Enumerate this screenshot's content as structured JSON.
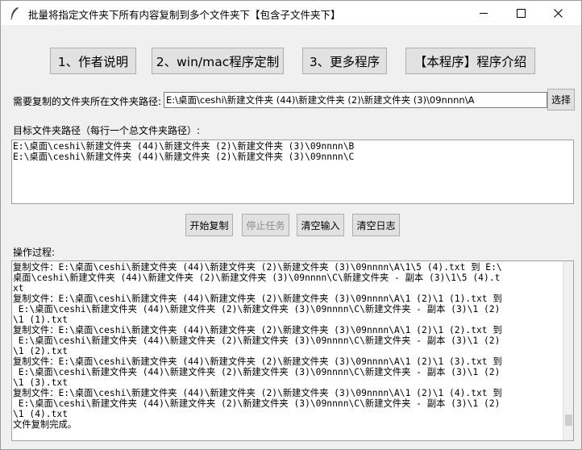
{
  "window": {
    "title": "批量将指定文件夹下所有内容复制到多个文件夹下【包含子文件夹下】"
  },
  "top_buttons": {
    "author": "1、作者说明",
    "custom": "2、win/mac程序定制",
    "more": "3、更多程序",
    "intro": "【本程序】程序介绍"
  },
  "source": {
    "label": "需要复制的文件夹所在文件夹路径:",
    "value": "E:\\桌面\\ceshi\\新建文件夹 (44)\\新建文件夹 (2)\\新建文件夹 (3)\\09nnnn\\A",
    "browse_label": "选择"
  },
  "targets": {
    "label": "目标文件夹路径（每行一个总文件夹路径）:",
    "lines": [
      "E:\\桌面\\ceshi\\新建文件夹 (44)\\新建文件夹 (2)\\新建文件夹 (3)\\09nnnn\\B",
      "E:\\桌面\\ceshi\\新建文件夹 (44)\\新建文件夹 (2)\\新建文件夹 (3)\\09nnnn\\C"
    ]
  },
  "actions": {
    "start": "开始复制",
    "stop": "停止任务",
    "clear_input": "清空输入",
    "clear_log": "清空日志"
  },
  "log": {
    "label": "操作过程:",
    "lines": [
      "复制文件：E:\\桌面\\ceshi\\新建文件夹 (44)\\新建文件夹 (2)\\新建文件夹 (3)\\09nnnn\\A\\1\\5 (4).txt 到 E:\\",
      "桌面\\ceshi\\新建文件夹 (44)\\新建文件夹 (2)\\新建文件夹 (3)\\09nnnn\\C\\新建文件夹 - 副本 (3)\\1\\5 (4).t",
      "xt",
      "复制文件：E:\\桌面\\ceshi\\新建文件夹 (44)\\新建文件夹 (2)\\新建文件夹 (3)\\09nnnn\\A\\1 (2)\\1 (1).txt 到",
      " E:\\桌面\\ceshi\\新建文件夹 (44)\\新建文件夹 (2)\\新建文件夹 (3)\\09nnnn\\C\\新建文件夹 - 副本 (3)\\1 (2)",
      "\\1 (1).txt",
      "复制文件：E:\\桌面\\ceshi\\新建文件夹 (44)\\新建文件夹 (2)\\新建文件夹 (3)\\09nnnn\\A\\1 (2)\\1 (2).txt 到",
      " E:\\桌面\\ceshi\\新建文件夹 (44)\\新建文件夹 (2)\\新建文件夹 (3)\\09nnnn\\C\\新建文件夹 - 副本 (3)\\1 (2)",
      "\\1 (2).txt",
      "复制文件：E:\\桌面\\ceshi\\新建文件夹 (44)\\新建文件夹 (2)\\新建文件夹 (3)\\09nnnn\\A\\1 (2)\\1 (3).txt 到",
      " E:\\桌面\\ceshi\\新建文件夹 (44)\\新建文件夹 (2)\\新建文件夹 (3)\\09nnnn\\C\\新建文件夹 - 副本 (3)\\1 (2)",
      "\\1 (3).txt",
      "复制文件：E:\\桌面\\ceshi\\新建文件夹 (44)\\新建文件夹 (2)\\新建文件夹 (3)\\09nnnn\\A\\1 (2)\\1 (4).txt 到",
      " E:\\桌面\\ceshi\\新建文件夹 (44)\\新建文件夹 (2)\\新建文件夹 (3)\\09nnnn\\C\\新建文件夹 - 副本 (3)\\1 (2)",
      "\\1 (4).txt",
      "文件复制完成。"
    ]
  }
}
